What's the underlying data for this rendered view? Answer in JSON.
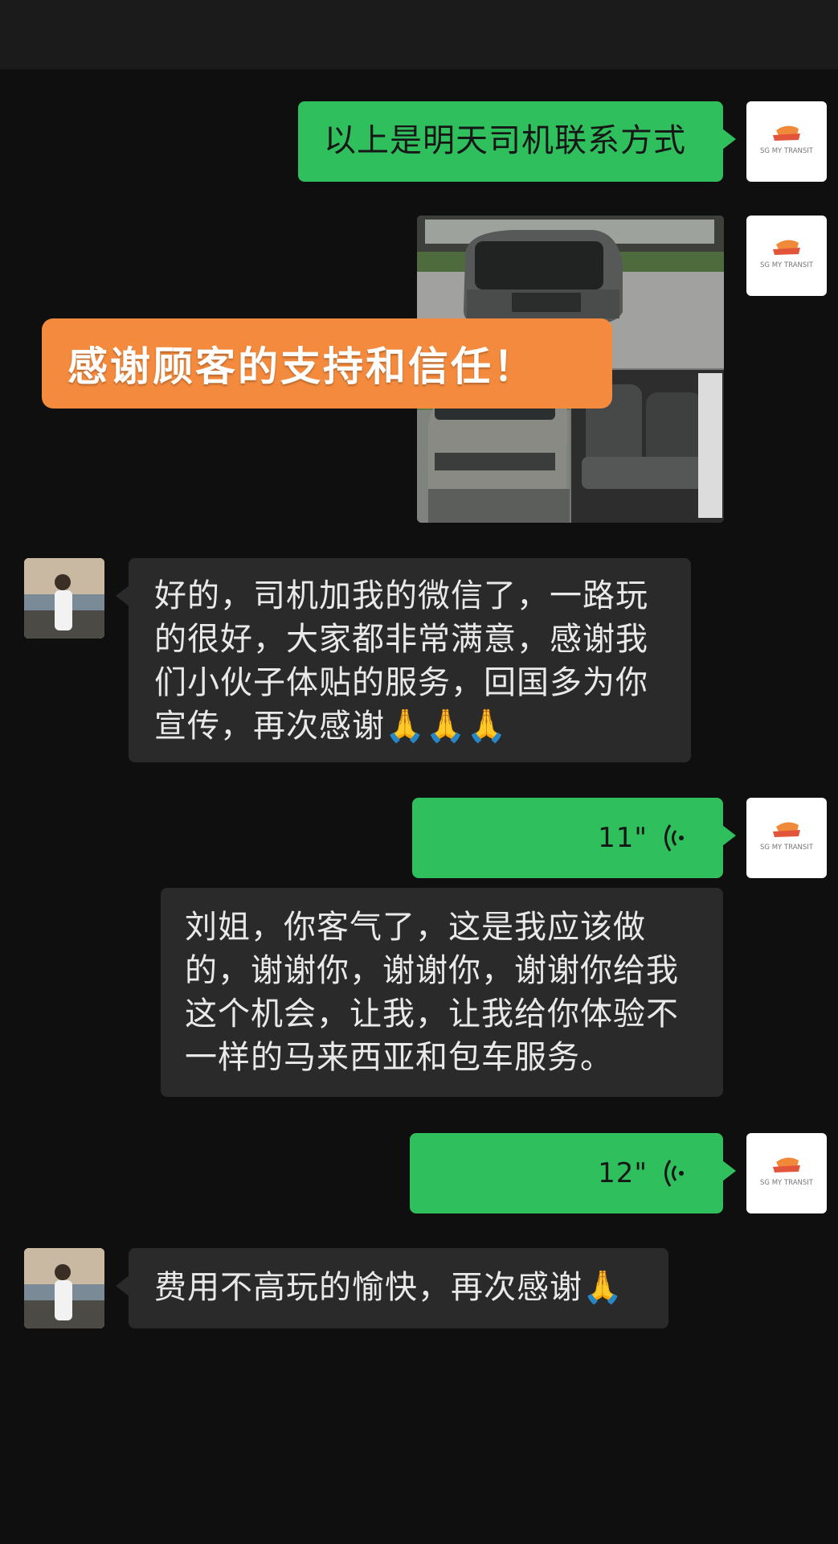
{
  "messages": [
    {
      "sender": "business",
      "type": "text",
      "text": "以上是明天司机联系方式"
    },
    {
      "sender": "business",
      "type": "image",
      "alt": "van-photos"
    },
    {
      "sender": "customer",
      "type": "text",
      "text": "好的，司机加我的微信了，一路玩\n的很好，大家都非常满意，感谢我\n们小伙子体贴的服务，回国多为你\n宣传，再次感谢",
      "emoji": "🙏🙏🙏"
    },
    {
      "sender": "business",
      "type": "voice",
      "duration": "11\""
    },
    {
      "sender": "business",
      "type": "transcript",
      "text": "刘姐，你客气了，这是我应该做\n的，谢谢你，谢谢你，谢谢你给我\n这个机会，让我，让我给你体验不\n一样的马来西亚和包车服务。"
    },
    {
      "sender": "business",
      "type": "voice",
      "duration": "12\""
    },
    {
      "sender": "customer",
      "type": "text",
      "text": "费用不高玩的愉快，再次感谢",
      "emoji": "🙏"
    }
  ],
  "overlay_banner": "感谢顾客的支持和信任！",
  "business_avatar": {
    "logo_text": "SG MY TRANSIT"
  },
  "colors": {
    "outgoing": "#2fbf5d",
    "incoming": "#2a2a2a",
    "banner": "#f38a3d",
    "background": "#0f0f0f"
  }
}
